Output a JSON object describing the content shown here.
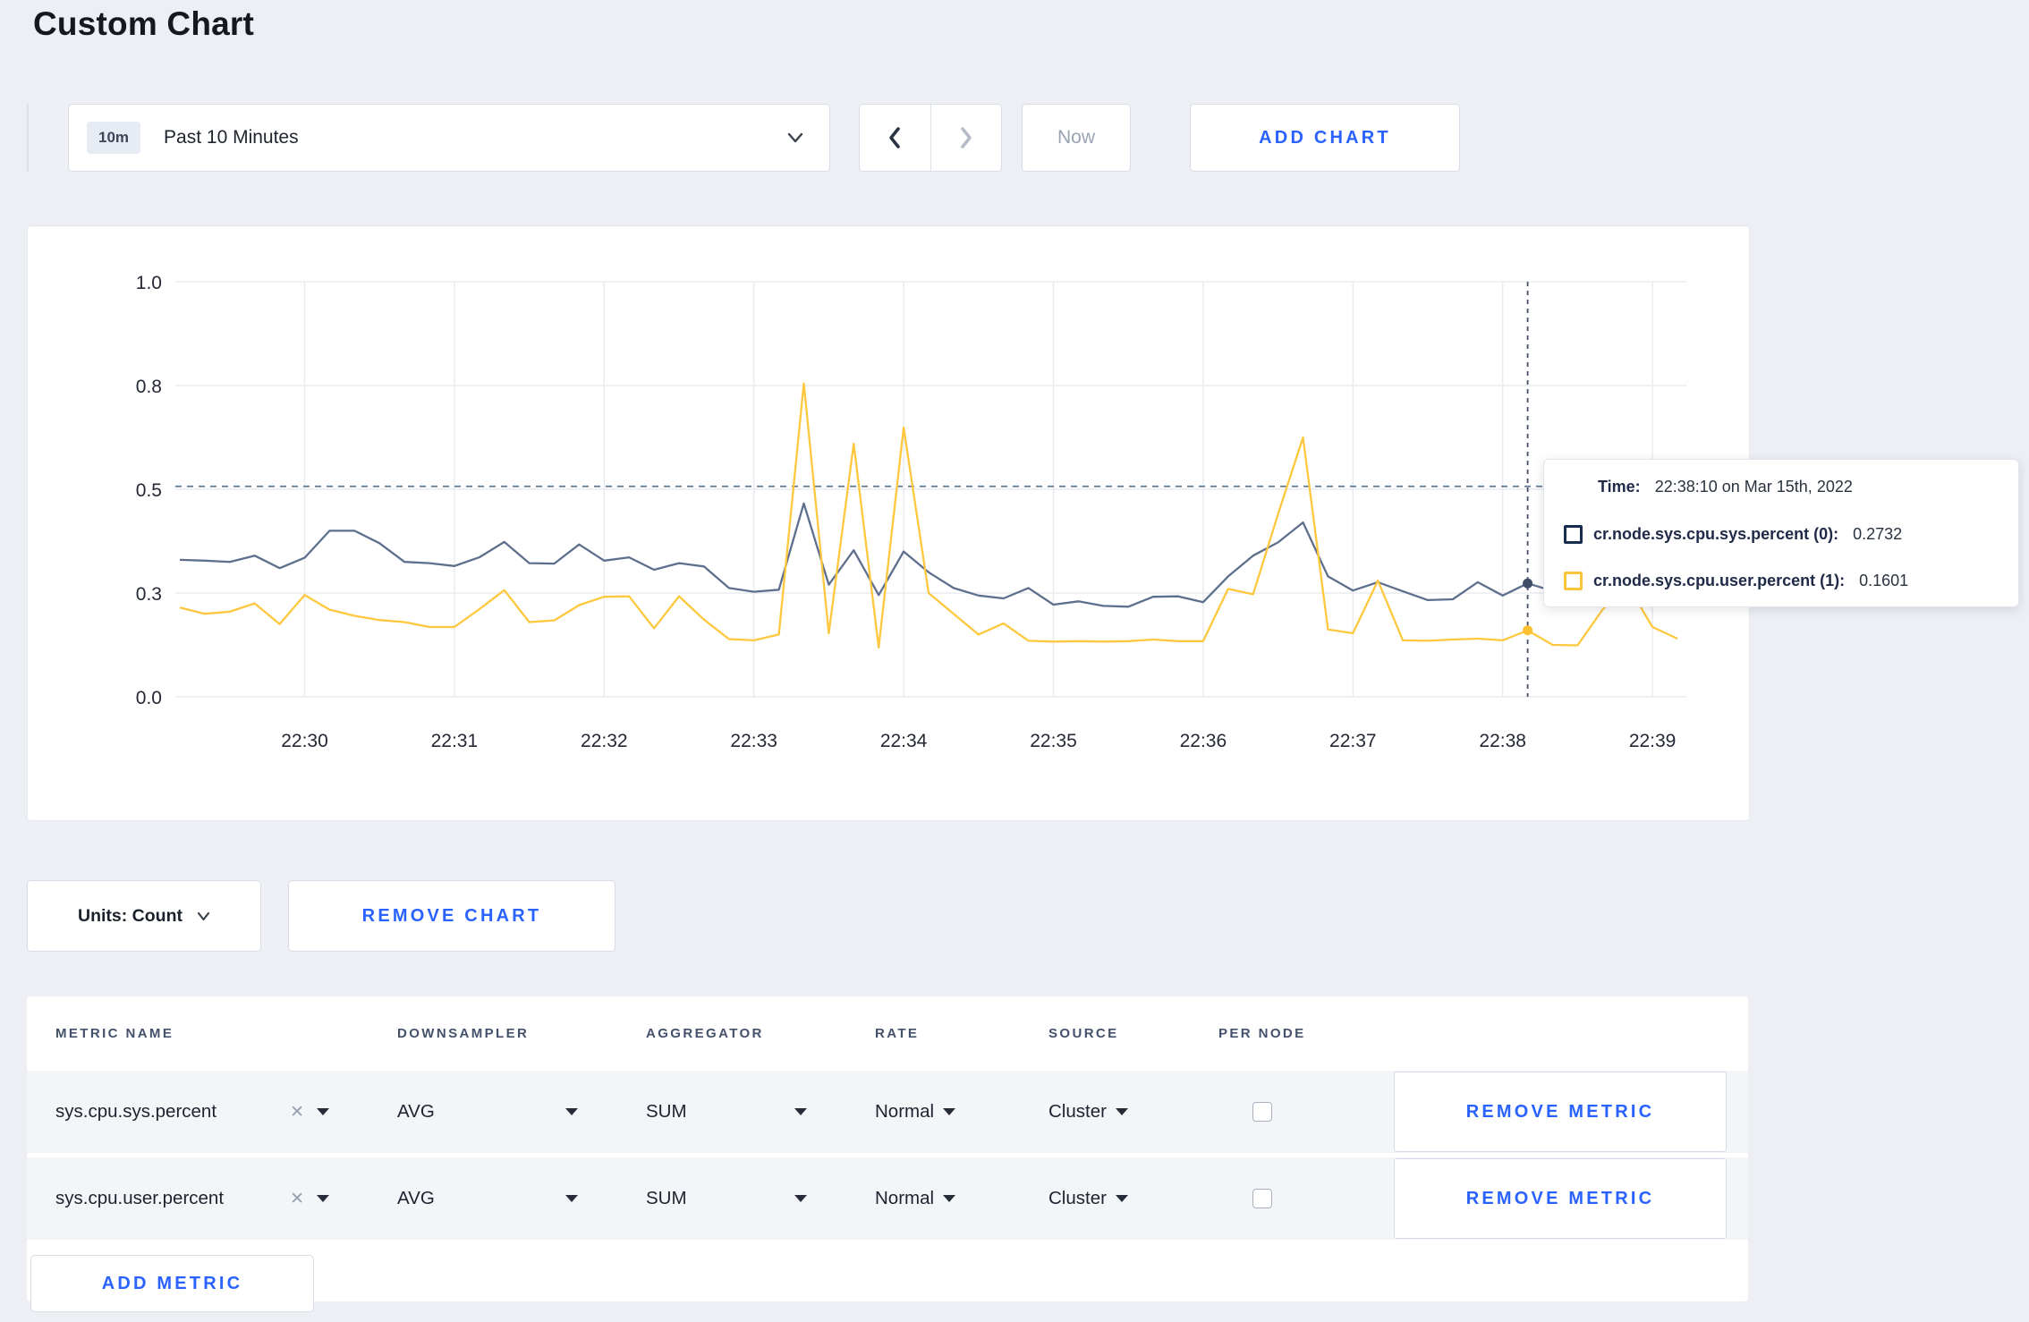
{
  "page": {
    "title": "Custom Chart"
  },
  "toolbar": {
    "range_badge": "10m",
    "range_label": "Past 10 Minutes",
    "now_label": "Now",
    "add_chart_label": "ADD CHART"
  },
  "chart_data": {
    "type": "line",
    "title": "",
    "xlabel": "",
    "ylabel": "",
    "ylim": [
      0,
      1
    ],
    "grid": true,
    "legend_position": "tooltip",
    "x_start": "22:29:10",
    "x_interval_seconds": 10,
    "x_ticks": [
      {
        "label": "22:30",
        "index": 5
      },
      {
        "label": "22:31",
        "index": 11
      },
      {
        "label": "22:32",
        "index": 17
      },
      {
        "label": "22:33",
        "index": 23
      },
      {
        "label": "22:34",
        "index": 29
      },
      {
        "label": "22:35",
        "index": 35
      },
      {
        "label": "22:36",
        "index": 41
      },
      {
        "label": "22:37",
        "index": 47
      },
      {
        "label": "22:38",
        "index": 53
      },
      {
        "label": "22:39",
        "index": 59
      }
    ],
    "y_ticks": [
      {
        "label": "0.0",
        "value": 0
      },
      {
        "label": "0.3",
        "value": 0.25
      },
      {
        "label": "0.5",
        "value": 0.5
      },
      {
        "label": "0.8",
        "value": 0.75
      },
      {
        "label": "1.0",
        "value": 1.0
      }
    ],
    "ref_line_value": 0.507,
    "hover_index": 54,
    "hover_time": "22:38:10",
    "series": [
      {
        "name": "cr.node.sys.cpu.sys.percent (0)",
        "color": "#5e6f8e",
        "dot_color": "#3e4c68",
        "values": [
          0.33,
          0.328,
          0.325,
          0.34,
          0.31,
          0.335,
          0.4,
          0.4,
          0.37,
          0.325,
          0.322,
          0.315,
          0.336,
          0.373,
          0.322,
          0.321,
          0.367,
          0.328,
          0.336,
          0.306,
          0.322,
          0.314,
          0.262,
          0.253,
          0.258,
          0.466,
          0.27,
          0.353,
          0.245,
          0.35,
          0.3,
          0.262,
          0.244,
          0.237,
          0.262,
          0.222,
          0.23,
          0.219,
          0.217,
          0.241,
          0.242,
          0.228,
          0.29,
          0.34,
          0.372,
          0.42,
          0.29,
          0.256,
          0.276,
          0.254,
          0.233,
          0.235,
          0.276,
          0.244,
          0.2732,
          0.255,
          0.262,
          0.27,
          0.28,
          0.292,
          0.3
        ]
      },
      {
        "name": "cr.node.sys.cpu.user.percent (1)",
        "color": "#fdc83e",
        "dot_color": "#fcc030",
        "values": [
          0.215,
          0.2,
          0.205,
          0.225,
          0.175,
          0.245,
          0.21,
          0.195,
          0.185,
          0.18,
          0.168,
          0.168,
          0.211,
          0.257,
          0.18,
          0.184,
          0.221,
          0.241,
          0.242,
          0.165,
          0.242,
          0.186,
          0.139,
          0.136,
          0.15,
          0.755,
          0.153,
          0.61,
          0.119,
          0.649,
          0.25,
          0.2,
          0.15,
          0.177,
          0.135,
          0.133,
          0.134,
          0.133,
          0.134,
          0.138,
          0.134,
          0.134,
          0.26,
          0.247,
          0.44,
          0.625,
          0.162,
          0.153,
          0.28,
          0.136,
          0.135,
          0.138,
          0.14,
          0.136,
          0.1601,
          0.125,
          0.124,
          0.21,
          0.27,
          0.168,
          0.14
        ]
      }
    ]
  },
  "tooltip": {
    "time_label": "Time:",
    "time_value": "22:38:10 on Mar 15th, 2022",
    "rows": [
      {
        "name": "cr.node.sys.cpu.sys.percent (0):",
        "value": "0.2732",
        "color": "#182c4e"
      },
      {
        "name": "cr.node.sys.cpu.user.percent (1):",
        "value": "0.1601",
        "color": "#fdc53b"
      }
    ]
  },
  "units": {
    "label": "Units: Count"
  },
  "chart_actions": {
    "remove_chart_label": "REMOVE CHART"
  },
  "metrics_table": {
    "headers": [
      "METRIC NAME",
      "DOWNSAMPLER",
      "AGGREGATOR",
      "RATE",
      "SOURCE",
      "PER NODE"
    ],
    "rows": [
      {
        "metric": "sys.cpu.sys.percent",
        "downsampler": "AVG",
        "aggregator": "SUM",
        "rate": "Normal",
        "source": "Cluster",
        "per_node_checked": false,
        "remove_label": "REMOVE METRIC"
      },
      {
        "metric": "sys.cpu.user.percent",
        "downsampler": "AVG",
        "aggregator": "SUM",
        "rate": "Normal",
        "source": "Cluster",
        "per_node_checked": false,
        "remove_label": "REMOVE METRIC"
      }
    ],
    "add_metric_label": "ADD METRIC"
  }
}
